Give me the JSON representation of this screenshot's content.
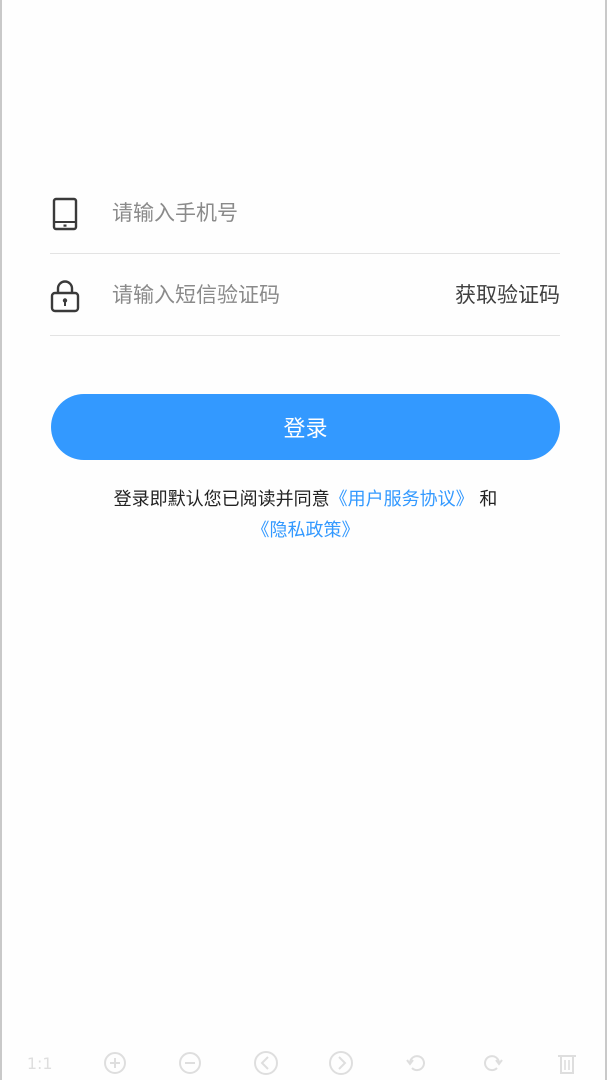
{
  "phone_field": {
    "placeholder": "请输入手机号",
    "value": "",
    "icon": "tablet-icon"
  },
  "code_field": {
    "placeholder": "请输入短信验证码",
    "value": "",
    "icon": "lock-icon",
    "get_code_label": "获取验证码"
  },
  "login_button": {
    "label": "登录"
  },
  "agreement": {
    "prefix": "登录即默认您已阅读并同意",
    "terms_link": "《用户服务协议》",
    "conjunction": "和",
    "privacy_link": "《隐私政策》"
  },
  "viewer_toolbar": {
    "zoom_label": "1:1"
  },
  "colors": {
    "accent": "#3399ff",
    "divider": "#e3e3e3",
    "placeholder": "#8a8a8a"
  }
}
